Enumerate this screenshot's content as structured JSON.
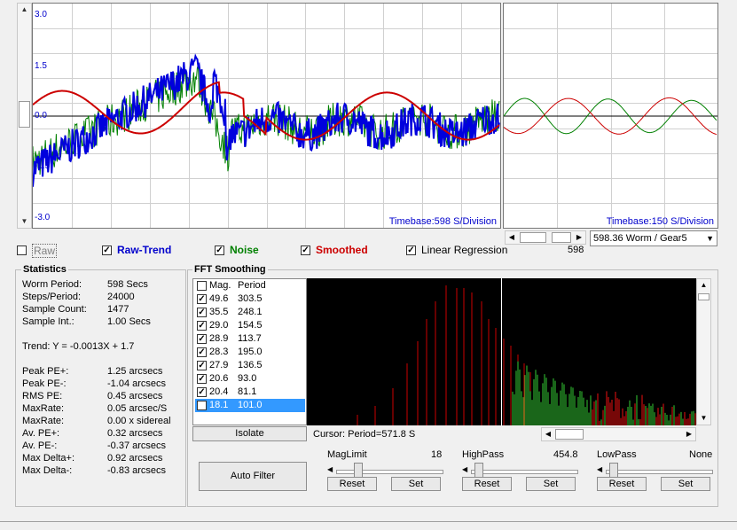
{
  "main_plot": {
    "y_ticks": [
      "3.0",
      "1.5",
      "0.0",
      "-1.5",
      "-3.0"
    ],
    "timebase": "Timebase:598 S/Division"
  },
  "side_plot": {
    "timebase": "Timebase:150 S/Division"
  },
  "checkboxes": [
    {
      "label": "Raw",
      "checked": false,
      "color": "#808080"
    },
    {
      "label": "Raw-Trend",
      "checked": true,
      "color": "#0000cc"
    },
    {
      "label": "Noise",
      "checked": true,
      "color": "#008000"
    },
    {
      "label": "Smoothed",
      "checked": true,
      "color": "#cc0000"
    },
    {
      "label": "Linear Regression",
      "checked": true,
      "color": "#000000"
    }
  ],
  "side_scroll": {
    "value": "598"
  },
  "worm_select": {
    "value": "598.36 Worm / Gear5"
  },
  "statistics": {
    "title": "Statistics",
    "rows": [
      {
        "label": "Worm Period:",
        "value": "598 Secs"
      },
      {
        "label": "Steps/Period:",
        "value": "24000"
      },
      {
        "label": "Sample Count:",
        "value": "1477"
      },
      {
        "label": "Sample Int.:",
        "value": "1.00 Secs"
      }
    ],
    "trend": "Trend: Y = -0.0013X + 1.7",
    "rows2": [
      {
        "label": "Peak PE+:",
        "value": "1.25 arcsecs"
      },
      {
        "label": "Peak PE-:",
        "value": "-1.04 arcsecs"
      },
      {
        "label": "RMS PE:",
        "value": "0.45 arcsecs"
      },
      {
        "label": "MaxRate:",
        "value": "0.05 arcsec/S"
      },
      {
        "label": "MaxRate:",
        "value": "0.00 x sidereal"
      },
      {
        "label": "Av. PE+:",
        "value": "0.32 arcsecs"
      },
      {
        "label": "Av. PE-:",
        "value": "-0.37 arcsecs"
      },
      {
        "label": "Max Delta+:",
        "value": "0.92 arcsecs"
      },
      {
        "label": "Max Delta-:",
        "value": "-0.83 arcsecs"
      }
    ]
  },
  "fft": {
    "title": "FFT Smoothing",
    "list_header": {
      "mag": "Mag.",
      "period": "Period"
    },
    "list": [
      {
        "mag": "49.6",
        "period": "303.5"
      },
      {
        "mag": "35.5",
        "period": "248.1"
      },
      {
        "mag": "29.0",
        "period": "154.5"
      },
      {
        "mag": "28.9",
        "period": "113.7"
      },
      {
        "mag": "28.3",
        "period": "195.0"
      },
      {
        "mag": "27.9",
        "period": "136.5"
      },
      {
        "mag": "20.6",
        "period": "93.0"
      },
      {
        "mag": "20.4",
        "period": "81.1"
      },
      {
        "mag": "18.1",
        "period": "101.0"
      }
    ],
    "isolate_label": "Isolate",
    "cursor_label": "Cursor: Period=571.8 S",
    "auto_filter_label": "Auto Filter",
    "maglimit": {
      "label": "MagLimit",
      "value": "18"
    },
    "highpass": {
      "label": "HighPass",
      "value": "454.8"
    },
    "lowpass": {
      "label": "LowPass",
      "value": "None"
    },
    "reset_label": "Reset",
    "set_label": "Set"
  }
}
